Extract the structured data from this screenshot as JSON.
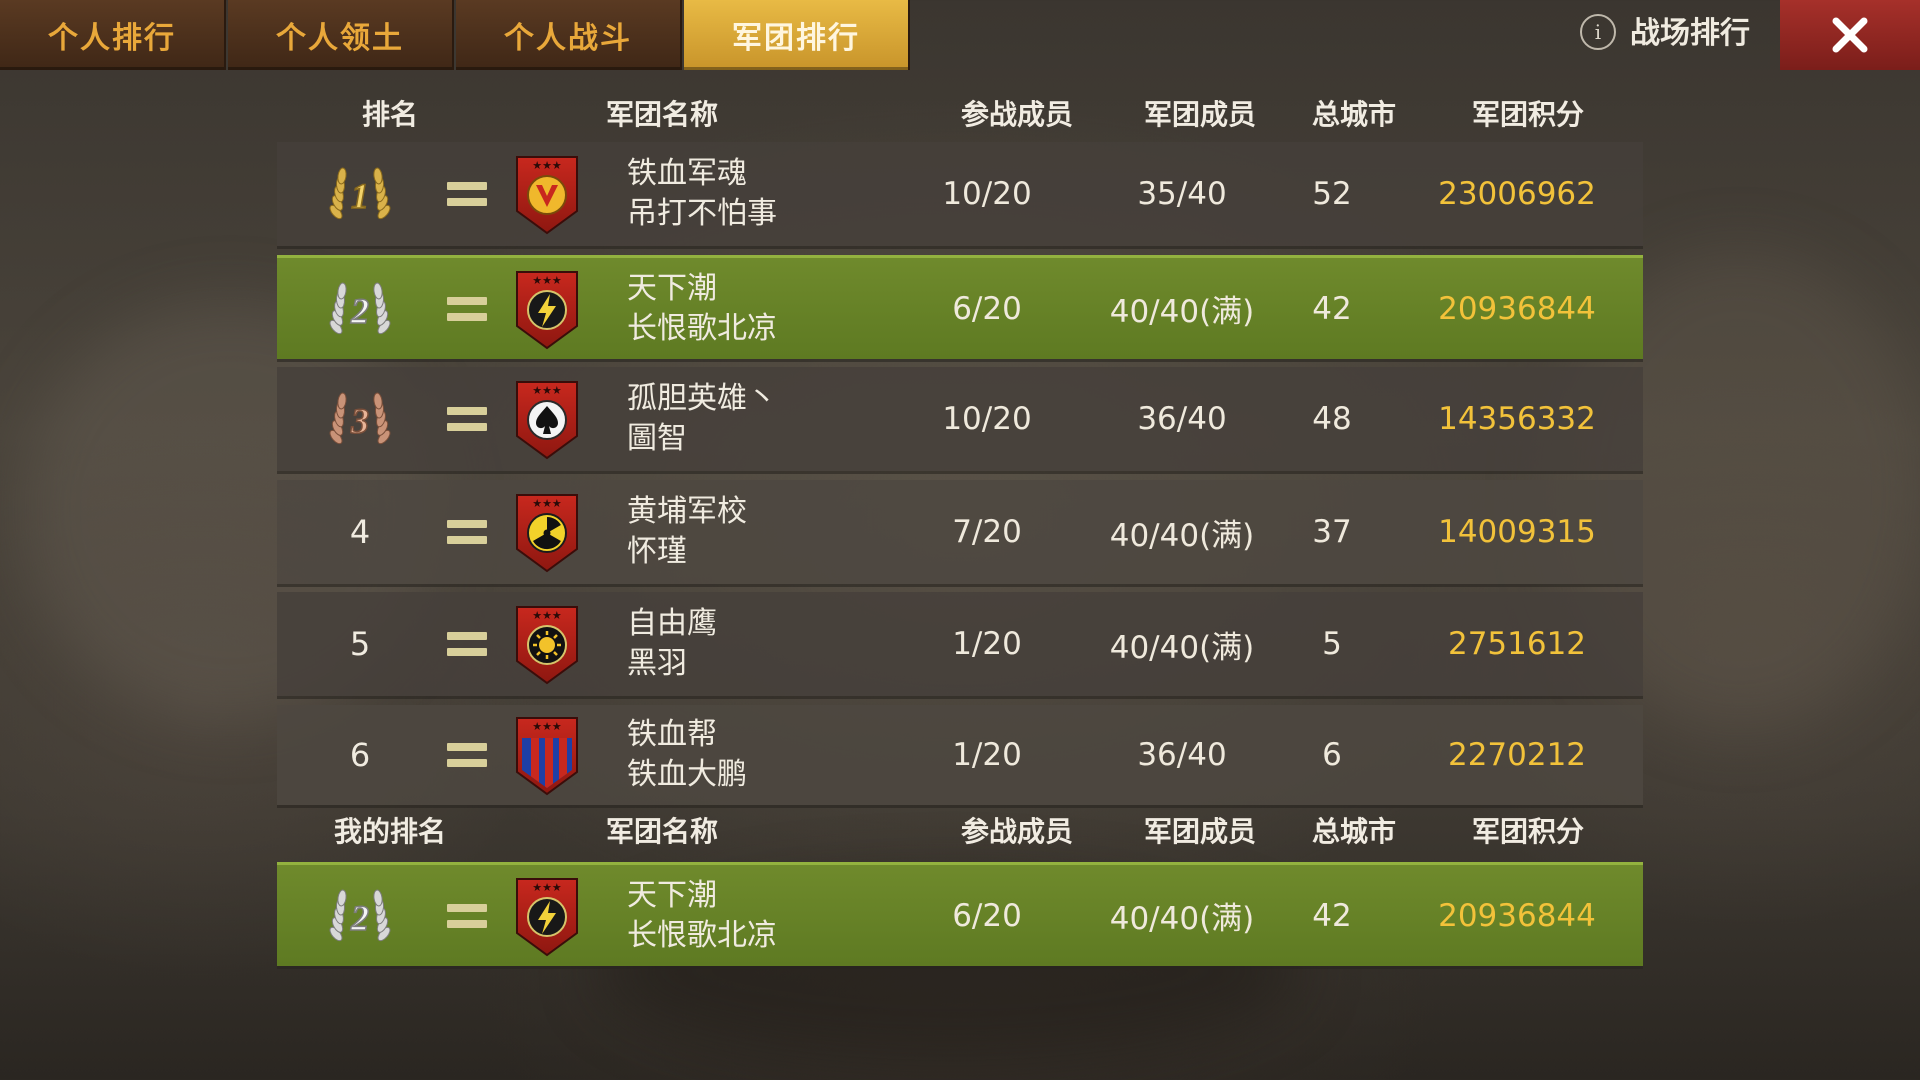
{
  "tabs": [
    {
      "label": "个人排行",
      "active": false
    },
    {
      "label": "个人领土",
      "active": false
    },
    {
      "label": "个人战斗",
      "active": false
    },
    {
      "label": "军团排行",
      "active": true
    }
  ],
  "info": {
    "icon": "i",
    "label": "战场排行"
  },
  "close_icon": "close-icon",
  "headers": {
    "rank": "排名",
    "name": "军团名称",
    "participants": "参战成员",
    "members": "军团成员",
    "cities": "总城市",
    "score": "军团积分"
  },
  "my_headers": {
    "rank": "我的排名",
    "name": "军团名称",
    "participants": "参战成员",
    "members": "军团成员",
    "cities": "总城市",
    "score": "军团积分"
  },
  "rows": [
    {
      "rank": "1",
      "rank_style": "gold-laurel",
      "change": "no-change",
      "badge": "v-emblem",
      "legion": "铁血军魂",
      "leader": "吊打不怕事",
      "participants": "10/20",
      "members": "35/40",
      "cities": "52",
      "score": "23006962"
    },
    {
      "rank": "2",
      "rank_style": "silver-laurel",
      "change": "no-change",
      "badge": "lightning-emblem",
      "legion": "天下潮",
      "leader": "长恨歌北凉",
      "participants": "6/20",
      "members": "40/40(满)",
      "cities": "42",
      "score": "20936844",
      "highlight": true
    },
    {
      "rank": "3",
      "rank_style": "bronze-laurel",
      "change": "no-change",
      "badge": "spade-emblem",
      "legion": "孤胆英雄丶",
      "leader": "圖智",
      "participants": "10/20",
      "members": "36/40",
      "cities": "48",
      "score": "14356332"
    },
    {
      "rank": "4",
      "rank_style": "plain",
      "change": "no-change",
      "badge": "radiation-emblem",
      "legion": "黄埔军校",
      "leader": "怀瑾",
      "participants": "7/20",
      "members": "40/40(满)",
      "cities": "37",
      "score": "14009315"
    },
    {
      "rank": "5",
      "rank_style": "plain",
      "change": "no-change",
      "badge": "sun-emblem",
      "legion": "自由鹰",
      "leader": "黑羽",
      "participants": "1/20",
      "members": "40/40(满)",
      "cities": "5",
      "score": "2751612"
    },
    {
      "rank": "6",
      "rank_style": "plain",
      "change": "no-change",
      "badge": "stripes-emblem",
      "legion": "铁血帮",
      "leader": "铁血大鹏",
      "participants": "1/20",
      "members": "36/40",
      "cities": "6",
      "score": "2270212"
    }
  ],
  "my_rank": {
    "rank": "2",
    "rank_style": "silver-laurel",
    "change": "no-change",
    "badge": "lightning-emblem",
    "legion": "天下潮",
    "leader": "长恨歌北凉",
    "participants": "6/20",
    "members": "40/40(满)",
    "cities": "42",
    "score": "20936844"
  },
  "colors": {
    "score": "#f2c23a",
    "tab_active": "#e8ba45",
    "tab_text": "#e9a83a",
    "highlight_row": "#6f8a2c",
    "close": "#a6302a"
  }
}
